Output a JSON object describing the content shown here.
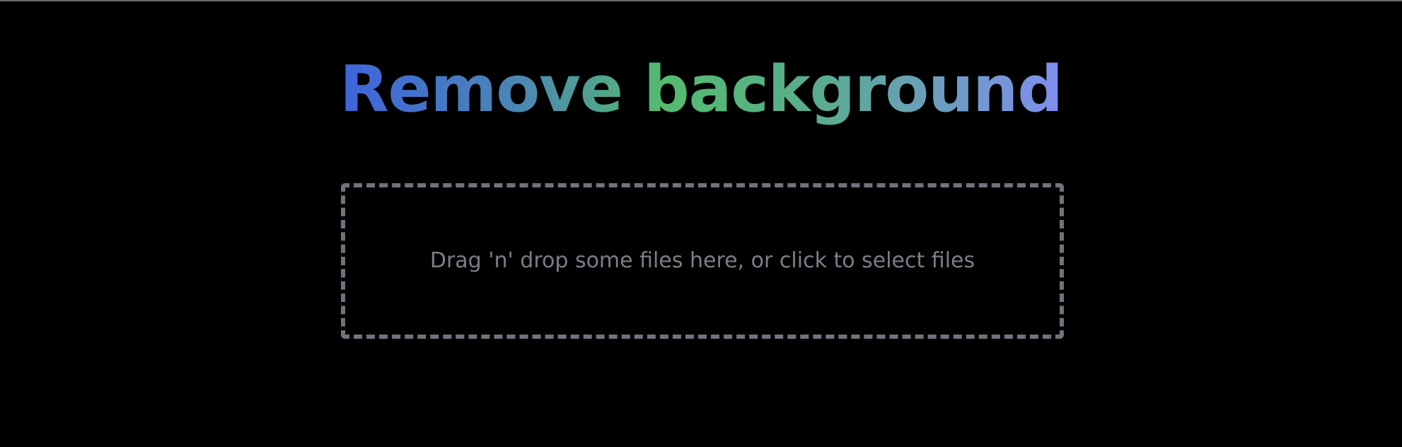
{
  "header": {
    "title": "Remove background"
  },
  "dropzone": {
    "prompt": "Drag 'n' drop some files here, or click to select files"
  },
  "colors": {
    "background": "#000000",
    "title_gradient": [
      "#3e63dd",
      "#55bb6e",
      "#7f8ef0"
    ],
    "dropzone_border": "#70737b",
    "dropzone_text": "#7b7e86"
  }
}
